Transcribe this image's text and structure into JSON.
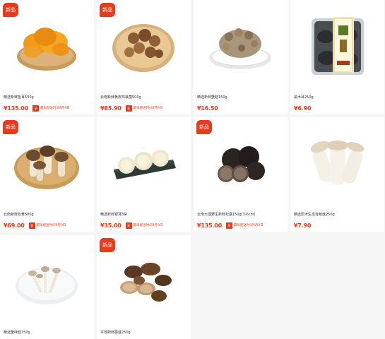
{
  "products": [
    {
      "name": "精选新鲜金耳500g",
      "price": "¥135.00",
      "badge": "新品",
      "has_badge": true,
      "tag": "享",
      "delivery": "最早配送时间9月9日",
      "icon": "golden-fungus-image"
    },
    {
      "name": "云南新鲜黄皮鸡枞菌500g",
      "price": "¥85.90",
      "badge": "新品",
      "has_badge": true,
      "tag": "享",
      "delivery": "最早配送时间9月9日",
      "icon": "termite-mushroom-image"
    },
    {
      "name": "精选新鲜蟹菇150g",
      "price": "¥16.50",
      "badge": "",
      "has_badge": false,
      "tag": "",
      "delivery": "",
      "icon": "crab-mushroom-image"
    },
    {
      "name": "黑木耳250g",
      "price": "¥6.90",
      "badge": "",
      "has_badge": false,
      "tag": "",
      "delivery": "",
      "icon": "black-fungus-package-image"
    },
    {
      "name": "云南新鲜松茸500g",
      "price": "¥69.00",
      "badge": "新品",
      "has_badge": true,
      "tag": "享",
      "delivery": "最早配送时间9月9日",
      "icon": "matsutake-image"
    },
    {
      "name": "精选新鲜银耳3朵",
      "price": "¥35.00",
      "badge": "",
      "has_badge": false,
      "tag": "享",
      "delivery": "最早配送时间9月9日",
      "icon": "white-fungus-image"
    },
    {
      "name": "云南大理野生新鲜松露150g(3-6cm)",
      "price": "¥135.00",
      "badge": "新品",
      "has_badge": true,
      "tag": "享",
      "delivery": "最早配送时间9月9日",
      "icon": "truffle-image"
    },
    {
      "name": "精选原木生态杏鲍菇250g",
      "price": "¥7.90",
      "badge": "",
      "has_badge": false,
      "tag": "",
      "delivery": "",
      "icon": "king-oyster-mushroom-image"
    },
    {
      "name": "精选蟹味菇150g",
      "price": "",
      "badge": "",
      "has_badge": false,
      "tag": "",
      "delivery": "",
      "icon": "white-beech-mushroom-image"
    },
    {
      "name": "本地新鲜香菇250g",
      "price": "",
      "badge": "新品",
      "has_badge": true,
      "tag": "",
      "delivery": "",
      "icon": "shiitake-image"
    }
  ],
  "colors": {
    "accent": "#e83a1c",
    "background": "#f5f5f5",
    "card": "#ffffff"
  }
}
